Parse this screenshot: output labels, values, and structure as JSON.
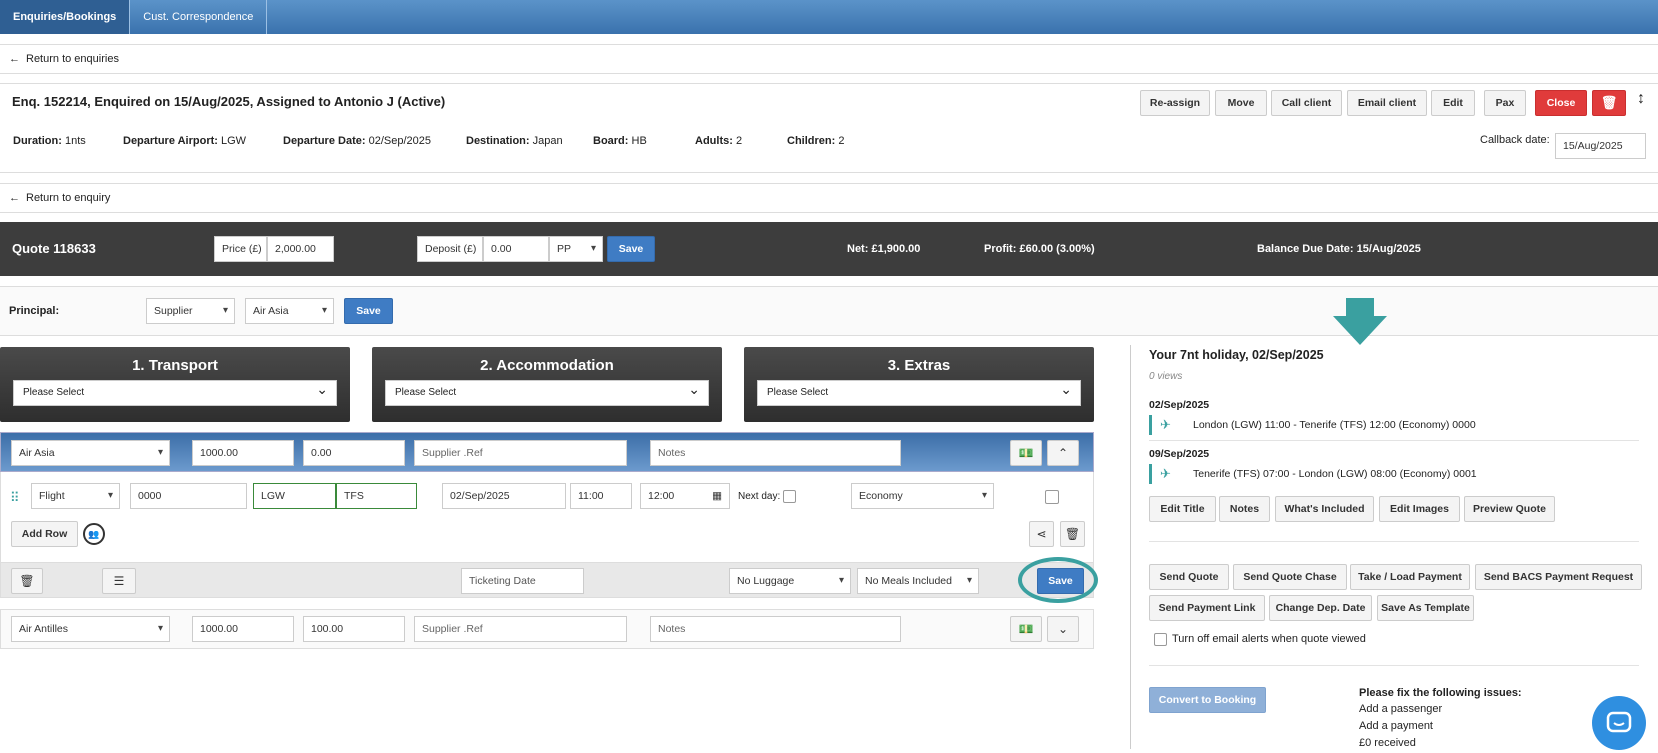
{
  "topnav": {
    "tab1": "Enquiries/Bookings",
    "tab2": "Cust. Correspondence"
  },
  "return_enquiries": "Return to enquiries",
  "return_enquiry": "Return to enquiry",
  "enquiry": {
    "title": "Enq. 152214, Enquired on 15/Aug/2025, Assigned to Antonio J (Active)",
    "buttons": [
      "Re-assign",
      "Move",
      "Call client",
      "Email client",
      "Edit",
      "Pax",
      "Close"
    ],
    "duration_label": "Duration:",
    "duration": "1nts",
    "airport_label": "Departure Airport:",
    "airport": "LGW",
    "date_label": "Departure Date:",
    "date": "02/Sep/2025",
    "dest_label": "Destination:",
    "dest": "Japan",
    "board_label": "Board:",
    "board": "HB",
    "adults_label": "Adults:",
    "adults": "2",
    "children_label": "Children:",
    "children": "2",
    "callback_label": "Callback date:",
    "callback": "15/Aug/2025"
  },
  "quote": {
    "title": "Quote 118633",
    "price_label": "Price (£)",
    "price": "2,000.00",
    "deposit_label": "Deposit (£)",
    "deposit": "0.00",
    "deposit_type": "PP",
    "save": "Save",
    "net_label": "Net:",
    "net": "£1,900.00",
    "profit_label": "Profit:",
    "profit": "£60.00 (3.00%)",
    "balance_label": "Balance Due Date:",
    "balance": "15/Aug/2025"
  },
  "principal": {
    "label": "Principal:",
    "type": "Supplier",
    "supplier": "Air Asia",
    "save": "Save"
  },
  "panels": [
    {
      "title": "1. Transport",
      "select": "Please Select"
    },
    {
      "title": "2. Accommodation",
      "select": "Please Select"
    },
    {
      "title": "3. Extras",
      "select": "Please Select"
    }
  ],
  "item1": {
    "supplier": "Air Asia",
    "cost": "1000.00",
    "extra": "0.00",
    "ref_placeholder": "Supplier .Ref",
    "notes_placeholder": "Notes"
  },
  "flight": {
    "type": "Flight",
    "number": "0000",
    "from": "LGW",
    "to": "TFS",
    "date": "02/Sep/2025",
    "dep": "11:00",
    "arr": "12:00",
    "nextday": "Next day:",
    "cabin": "Economy",
    "add_row": "Add Row",
    "ticketing": "Ticketing Date",
    "luggage": "No Luggage",
    "meals": "No Meals Included",
    "save": "Save"
  },
  "item2": {
    "supplier": "Air Antilles",
    "cost": "1000.00",
    "extra": "100.00",
    "ref_placeholder": "Supplier .Ref",
    "notes_placeholder": "Notes"
  },
  "side": {
    "title": "Your 7nt holiday, 02/Sep/2025",
    "views": "0 views",
    "legs": [
      {
        "date": "02/Sep/2025",
        "text": "London (LGW) 11:00 - Tenerife (TFS) 12:00 (Economy) 0000"
      },
      {
        "date": "09/Sep/2025",
        "text": "Tenerife (TFS) 07:00 - London (LGW) 08:00 (Economy) 0001"
      }
    ],
    "buttons1": [
      "Edit Title",
      "Notes",
      "What's Included",
      "Edit Images",
      "Preview Quote"
    ],
    "buttons2": [
      "Send Quote",
      "Send Quote Chase",
      "Take / Load Payment",
      "Send BACS Payment Request"
    ],
    "buttons3": [
      "Send Payment Link",
      "Change Dep. Date",
      "Save As Template"
    ],
    "email_alert": "Turn off email alerts when quote viewed",
    "convert": "Convert to Booking",
    "issues_title": "Please fix the following issues:",
    "issues": [
      "Add a passenger",
      "Add a payment",
      "£0 received"
    ]
  },
  "colors": {
    "accent": "#3f7cc4",
    "teal": "#3aa0a0",
    "red": "#e03b3b"
  }
}
